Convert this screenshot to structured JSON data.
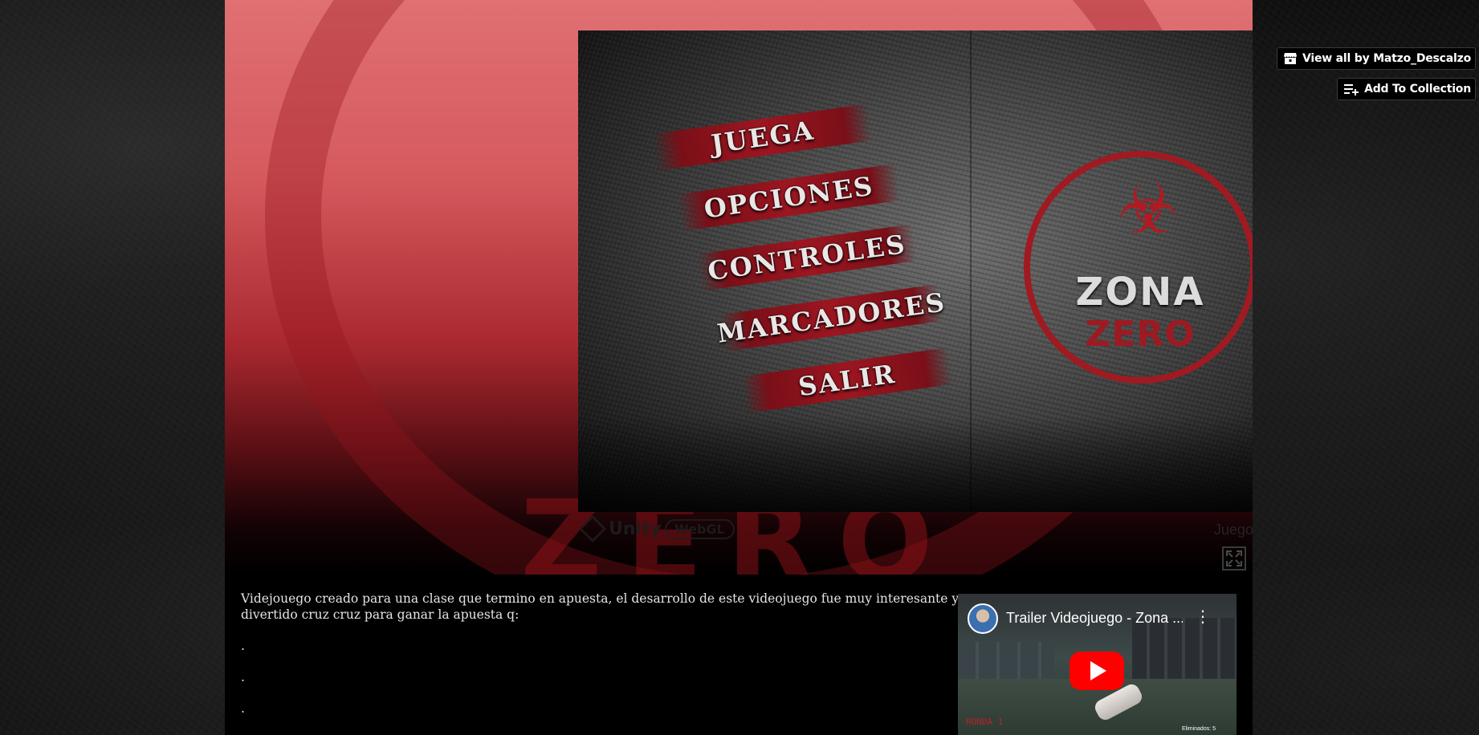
{
  "header_buttons": {
    "view_all_label": "View all by Matzo_Descalzo",
    "add_to_collection_label": "Add To Collection",
    "view_all_icon": "itchio-icon",
    "add_to_collection_icon": "playlist-add-icon"
  },
  "game": {
    "menu": [
      "JUEGA",
      "OPCIONES",
      "CONTROLES",
      "MARCADORES",
      "SALIR"
    ],
    "logo_line1": "ZONA",
    "logo_line2": "ZERO",
    "footer": {
      "unity_label": "Unity",
      "webgl_label": "WebGL",
      "title_label": "JuegoDeSaltos"
    }
  },
  "description": {
    "paragraph1": "Videjouego creado para una clase que termino en apuesta, el desarrollo de este videojuego fue muy interesante y divertido cruz cruz para ganar la apuesta q:",
    "dot1": ".",
    "dot2": ".",
    "dot3": "."
  },
  "video": {
    "title": "Trailer Videojuego - Zona ...",
    "hud_round": "RONDA 1",
    "hud_kills": "Eliminados: 5"
  },
  "colors": {
    "accent_fullscreen": "#29a6d8",
    "header_red": "#d55a5e",
    "menu_red": "#9c1621",
    "youtube_red": "#ff0000"
  }
}
